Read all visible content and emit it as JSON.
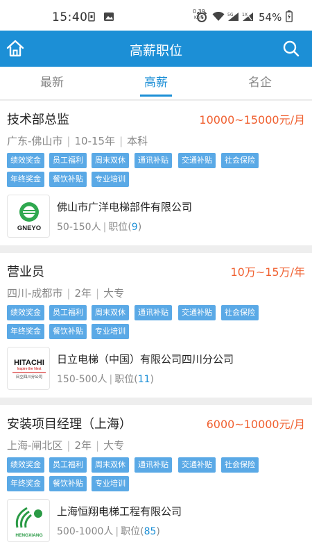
{
  "status_bar": {
    "time": "15:40",
    "net_speed_value": "0.39",
    "net_speed_unit": "KB/S",
    "battery": "54%"
  },
  "app_bar": {
    "title": "高薪职位"
  },
  "tabs": [
    {
      "label": "最新",
      "active": false
    },
    {
      "label": "高薪",
      "active": true
    },
    {
      "label": "名企",
      "active": false
    }
  ],
  "colors": {
    "primary": "#1c8fd6",
    "salary": "#f06030",
    "tag": "#5aa9e6"
  },
  "jobs": [
    {
      "title": "技术部总监",
      "salary": "10000~15000元/月",
      "location": "广东-佛山市",
      "experience": "10-15年",
      "education": "本科",
      "tags": [
        "绩效奖金",
        "员工福利",
        "周末双休",
        "通讯补贴",
        "交通补贴",
        "社会保险",
        "年终奖金",
        "餐饮补贴",
        "专业培训"
      ],
      "company": "佛山市广洋电梯部件有限公司",
      "company_size": "50-150人",
      "positions_label": "职位",
      "positions_open": "(",
      "positions_count": "9",
      "positions_close": ")",
      "logo_text": "GNEYO"
    },
    {
      "title": "营业员",
      "salary": "10万~15万/年",
      "location": "四川-成都市",
      "experience": "2年",
      "education": "大专",
      "tags": [
        "绩效奖金",
        "员工福利",
        "周末双休",
        "通讯补贴",
        "交通补贴",
        "社会保险",
        "年终奖金",
        "餐饮补贴",
        "专业培训"
      ],
      "company": "日立电梯（中国）有限公司四川分公司",
      "company_size": "150-500人",
      "positions_label": "职位",
      "positions_open": "(",
      "positions_count": "11",
      "positions_close": ")",
      "logo_text": "HITACHI",
      "logo_sub": "Inspire the Next",
      "logo_cn": "日立四川分公司"
    },
    {
      "title": "安装项目经理（上海）",
      "salary": "6000~10000元/月",
      "location": "上海-闸北区",
      "experience": "2年",
      "education": "大专",
      "tags": [
        "绩效奖金",
        "员工福利",
        "周末双休",
        "通讯补贴",
        "交通补贴",
        "社会保险",
        "年终奖金",
        "餐饮补贴",
        "专业培训"
      ],
      "company": "上海恒翔电梯工程有限公司",
      "company_size": "500-1000人",
      "positions_label": "职位",
      "positions_open": "(",
      "positions_count": "85",
      "positions_close": ")",
      "logo_text": "HENGXIANG"
    }
  ]
}
